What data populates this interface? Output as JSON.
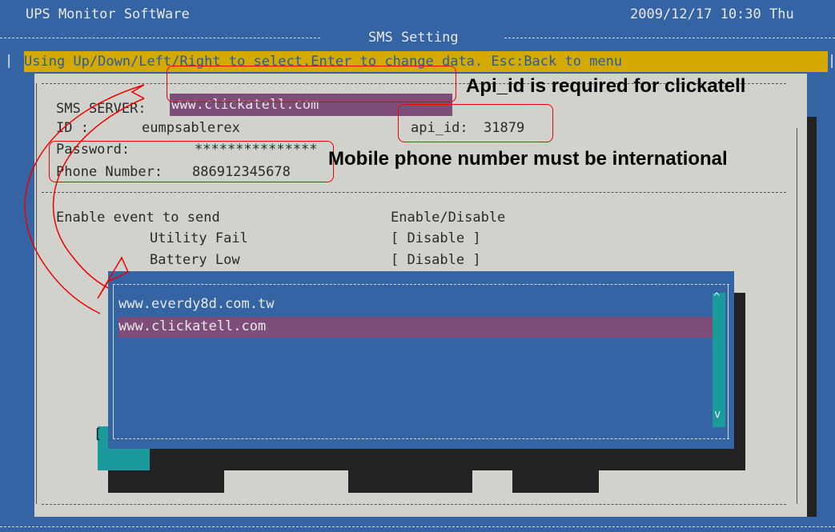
{
  "header": {
    "app_title": "UPS Monitor SoftWare",
    "datetime": "2009/12/17 10:30 Thu",
    "screen_title": "SMS Setting",
    "hint": "Using Up/Down/Left/Right to select.Enter to change data. Esc:Back to menu"
  },
  "form": {
    "server_label": "SMS SERVER:",
    "server_value": "www.clickatell.com",
    "id_label": "ID :",
    "id_value": "eumpsablerex",
    "api_id_label": "api_id:",
    "api_id_value": "31879",
    "password_label": "Password:",
    "password_value": "***************",
    "phone_label": "Phone Number:",
    "phone_value": "886912345678"
  },
  "events": {
    "section_label": "Enable event to send",
    "column_header": "Enable/Disable",
    "items": [
      {
        "label": "Utility Fail",
        "value": "[ Disable ]"
      },
      {
        "label": "Battery Low",
        "value": "[ Disable ]"
      }
    ]
  },
  "server_dialog": {
    "options": [
      "www.everdy8d.com.tw",
      "www.clickatell.com"
    ],
    "selected_index": 1,
    "scroll_up": "^",
    "scroll_down": "v",
    "bracket": "["
  },
  "annotations": {
    "note_api_id": "Api_id is required for clickatell",
    "note_phone": "Mobile phone number must be international"
  },
  "colors": {
    "background": "#3464a4",
    "panel": "#d2d2cc",
    "hint_bar": "#d4aa00",
    "highlight": "#7e4d7a",
    "scrollbar": "#1a9a9a",
    "annotation": "#e00000"
  },
  "icons": {
    "scroll_up": "caret-up-icon",
    "scroll_down": "caret-down-icon",
    "annotation_arrow": "curved-arrow-icon"
  }
}
